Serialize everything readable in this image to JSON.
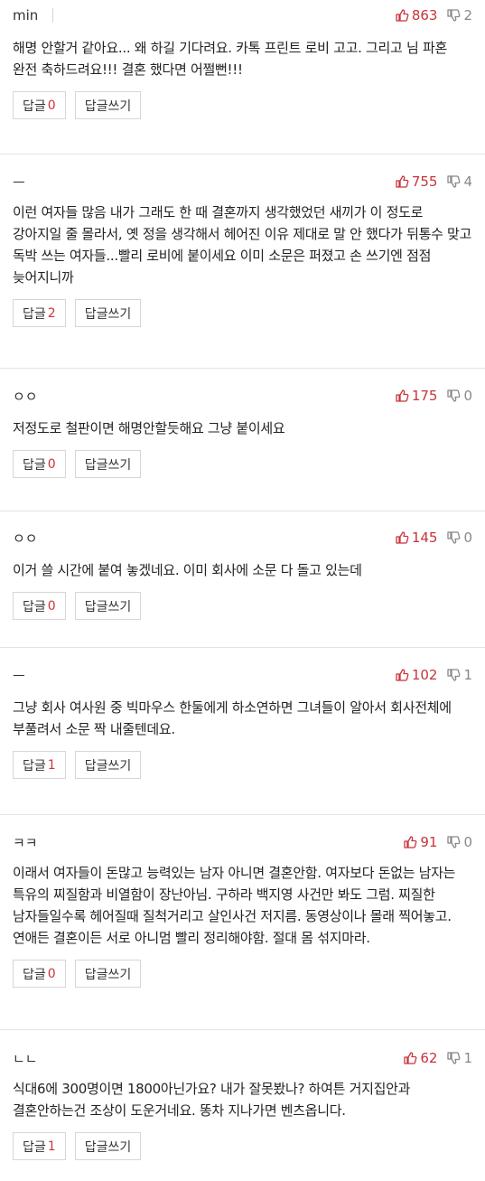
{
  "comments": [
    {
      "author": "min",
      "up": "863",
      "down": "2",
      "body": "해명 안할거 같아요... 왜 하길 기다려요. 카톡 프린트 로비 고고. 그리고 님 파혼 완전 축하드려요!!! 결혼 했다면 어쩔뻔!!!",
      "reply_label": "답글",
      "reply_count": "0",
      "write_label": "답글쓰기"
    },
    {
      "author": "ㅡ",
      "up": "755",
      "down": "4",
      "body": "이런 여자들 많음 내가 그래도 한 때 결혼까지 생각했었던 새끼가 이 정도로 강아지일 줄 몰라서, 옛 정을 생각해서 헤어진 이유 제대로 말 안 했다가 뒤통수 맞고 독박 쓰는 여자들...빨리 로비에 붙이세요 이미 소문은 퍼졌고 손 쓰기엔 점점 늦어지니까",
      "reply_label": "답글",
      "reply_count": "2",
      "write_label": "답글쓰기"
    },
    {
      "author": "ㅇㅇ",
      "up": "175",
      "down": "0",
      "body": "저정도로 철판이면 해명안할듯해요 그냥 붙이세요",
      "reply_label": "답글",
      "reply_count": "0",
      "write_label": "답글쓰기"
    },
    {
      "author": "ㅇㅇ",
      "up": "145",
      "down": "0",
      "body": "이거 쓸 시간에 붙여 놓겠네요. 이미 회사에 소문 다 돌고 있는데",
      "reply_label": "답글",
      "reply_count": "0",
      "write_label": "답글쓰기"
    },
    {
      "author": "ㅡ",
      "up": "102",
      "down": "1",
      "body": "그냥 회사 여사원 중 빅마우스 한둘에게 하소연하면 그녀들이 알아서 회사전체에 부풀려서 소문 짝 내줄텐데요.",
      "reply_label": "답글",
      "reply_count": "1",
      "write_label": "답글쓰기"
    },
    {
      "author": "ㅋㅋ",
      "up": "91",
      "down": "0",
      "body": "이래서 여자들이 돈많고 능력있는 남자 아니면 결혼안함. 여자보다 돈없는 남자는 특유의 찌질함과 비열함이 장난아님. 구하라 백지영 사건만 봐도 그럼. 찌질한 남자들일수록 헤어질때 질척거리고 살인사건 저지름. 동영상이나 몰래 찍어놓고. 연애든 결혼이든 서로 아니멈 빨리 정리해야함. 절대 몸 섞지마라.",
      "reply_label": "답글",
      "reply_count": "0",
      "write_label": "답글쓰기"
    },
    {
      "author": "ㄴㄴ",
      "up": "62",
      "down": "1",
      "body": "식대6에 300명이면 1800아닌가요? 내가 잘못봤나? 하여튼 거지집안과 결혼안하는건 조상이 도운거네요. 똥차 지나가면 벤츠옵니다.",
      "reply_label": "답글",
      "reply_count": "1",
      "write_label": "답글쓰기"
    }
  ],
  "colors": {
    "accent": "#c8333b",
    "muted": "#888888",
    "border": "#d6d6d6"
  }
}
